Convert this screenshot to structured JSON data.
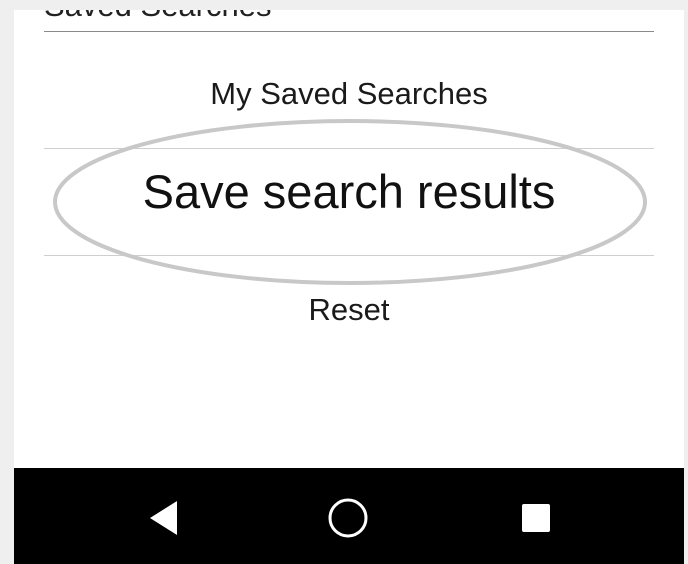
{
  "menu": {
    "cut_off_title": "Saved Searches",
    "items": [
      {
        "label": "My Saved Searches"
      },
      {
        "label": "Save search results",
        "highlighted": true
      },
      {
        "label": "Reset"
      }
    ]
  },
  "annotation": {
    "shape": "ellipse",
    "color": "#c8c8c8"
  },
  "navbar": {
    "background": "#000000",
    "icons": [
      "back-icon",
      "home-icon",
      "recent-apps-icon"
    ]
  }
}
